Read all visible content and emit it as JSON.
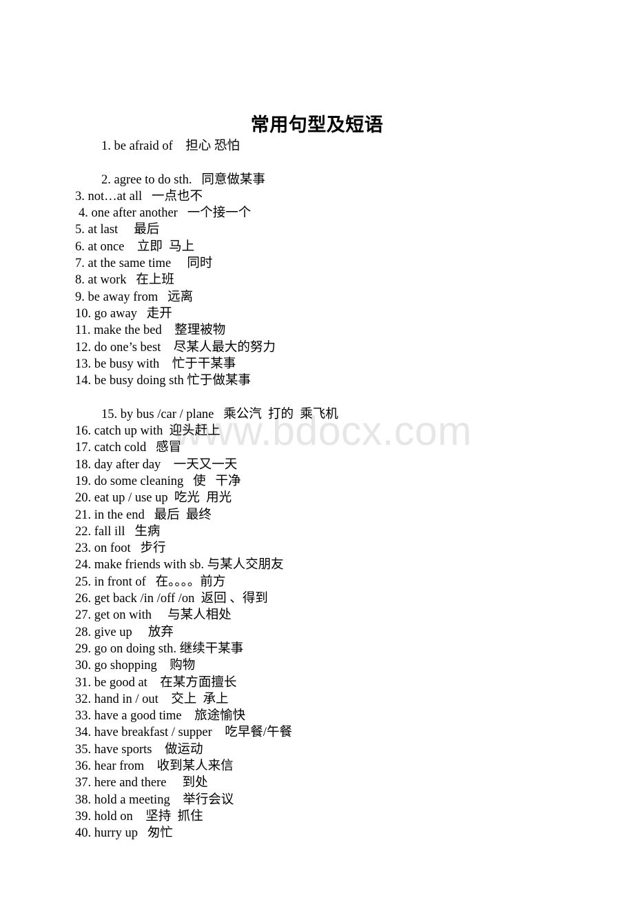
{
  "document": {
    "title": "常用句型及短语",
    "watermark": "www.bdocx.com",
    "watermark_color": "#e6e6e6",
    "background_color": "#ffffff",
    "text_color": "#000000"
  },
  "phrases": [
    {
      "num": "1.",
      "english": "be afraid of",
      "chinese": "担心 恐怕",
      "text": "1. be afraid of    担心 恐怕",
      "indent": "big"
    },
    {
      "num": "",
      "english": "",
      "chinese": "",
      "text": "",
      "indent": "spacer"
    },
    {
      "num": "2.",
      "english": "agree to do sth.",
      "chinese": "同意做某事",
      "text": "2. agree to do sth.   同意做某事",
      "indent": "big"
    },
    {
      "num": "3.",
      "english": "not…at all",
      "chinese": "一点也不",
      "text": "3. not…at all   一点也不",
      "indent": "none"
    },
    {
      "num": "4.",
      "english": "one after another",
      "chinese": "一个接一个",
      "text": "4. one after another   一个接一个",
      "indent": "small"
    },
    {
      "num": "5.",
      "english": "at last",
      "chinese": "最后",
      "text": "5. at last     最后",
      "indent": "none"
    },
    {
      "num": "6.",
      "english": "at once",
      "chinese": "立即 马上",
      "text": "6. at once    立即  马上",
      "indent": "none"
    },
    {
      "num": "7.",
      "english": "at the same time",
      "chinese": "同时",
      "text": "7. at the same time     同时",
      "indent": "none"
    },
    {
      "num": "8.",
      "english": "at work",
      "chinese": "在上班",
      "text": "8. at work   在上班",
      "indent": "none"
    },
    {
      "num": "9.",
      "english": "be away from",
      "chinese": "远离",
      "text": "9. be away from   远离",
      "indent": "none"
    },
    {
      "num": "10.",
      "english": "go away",
      "chinese": "走开",
      "text": "10. go away   走开",
      "indent": "none"
    },
    {
      "num": "11.",
      "english": "make the bed",
      "chinese": "整理被物",
      "text": "11. make the bed    整理被物",
      "indent": "none"
    },
    {
      "num": "12.",
      "english": "do one's best",
      "chinese": "尽某人最大的努力",
      "text": "12. do one’s best    尽某人最大的努力",
      "indent": "none"
    },
    {
      "num": "13.",
      "english": "be busy with",
      "chinese": "忙于干某事",
      "text": "13. be busy with    忙于干某事",
      "indent": "none"
    },
    {
      "num": "14.",
      "english": "be busy doing sth",
      "chinese": "忙于做某事",
      "text": "14. be busy doing sth 忙于做某事",
      "indent": "none"
    },
    {
      "num": "",
      "english": "",
      "chinese": "",
      "text": "",
      "indent": "spacer"
    },
    {
      "num": "15.",
      "english": "by bus /car / plane",
      "chinese": "乘公汽 打的 乘飞机",
      "text": "15. by bus /car / plane   乘公汽  打的  乘飞机",
      "indent": "big"
    },
    {
      "num": "16.",
      "english": "catch up with",
      "chinese": "迎头赶上",
      "text": "16. catch up with  迎头赶上",
      "indent": "none"
    },
    {
      "num": "17.",
      "english": "catch cold",
      "chinese": "感冒",
      "text": "17. catch cold   感冒",
      "indent": "none"
    },
    {
      "num": "18.",
      "english": "day after day",
      "chinese": "一天又一天",
      "text": "18. day after day    一天又一天",
      "indent": "none"
    },
    {
      "num": "19.",
      "english": "do some cleaning",
      "chinese": "使 干净",
      "text": "19. do some cleaning   使   干净",
      "indent": "none"
    },
    {
      "num": "20.",
      "english": "eat up / use up",
      "chinese": "吃光 用光",
      "text": "20. eat up / use up  吃光  用光",
      "indent": "none"
    },
    {
      "num": "21.",
      "english": "in the end",
      "chinese": "最后 最终",
      "text": "21. in the end   最后  最终",
      "indent": "none"
    },
    {
      "num": "22.",
      "english": "fall ill",
      "chinese": "生病",
      "text": "22. fall ill   生病",
      "indent": "none"
    },
    {
      "num": "23.",
      "english": "on foot",
      "chinese": "步行",
      "text": "23. on foot   步行",
      "indent": "none"
    },
    {
      "num": "24.",
      "english": "make friends with sb.",
      "chinese": "与某人交朋友",
      "text": "24. make friends with sb. 与某人交朋友",
      "indent": "none"
    },
    {
      "num": "25.",
      "english": "in front of",
      "chinese": "在。。。。前方",
      "text": "25. in front of   在。。。。前方",
      "indent": "none"
    },
    {
      "num": "26.",
      "english": "get back /in /off /on",
      "chinese": "返回 、得到",
      "text": "26. get back /in /off /on  返回 、得到",
      "indent": "none"
    },
    {
      "num": "27.",
      "english": "get on with",
      "chinese": "与某人相处",
      "text": "27. get on with     与某人相处",
      "indent": "none"
    },
    {
      "num": "28.",
      "english": "give up",
      "chinese": "放弃",
      "text": "28. give up     放弃",
      "indent": "none"
    },
    {
      "num": "29.",
      "english": "go on doing sth.",
      "chinese": "继续干某事",
      "text": "29. go on doing sth. 继续干某事",
      "indent": "none"
    },
    {
      "num": "30.",
      "english": "go shopping",
      "chinese": "购物",
      "text": "30. go shopping    购物",
      "indent": "none"
    },
    {
      "num": "31.",
      "english": "be good at",
      "chinese": "在某方面擅长",
      "text": "31. be good at    在某方面擅长",
      "indent": "none"
    },
    {
      "num": "32.",
      "english": "hand in / out",
      "chinese": "交上 承上",
      "text": "32. hand in / out    交上  承上",
      "indent": "none"
    },
    {
      "num": "33.",
      "english": "have a good time",
      "chinese": "旅途愉快",
      "text": "33. have a good time    旅途愉快",
      "indent": "none"
    },
    {
      "num": "34.",
      "english": "have breakfast / supper",
      "chinese": "吃早餐/午餐",
      "text": "34. have breakfast / supper    吃早餐/午餐",
      "indent": "none"
    },
    {
      "num": "35.",
      "english": "have sports",
      "chinese": "做运动",
      "text": "35. have sports    做运动",
      "indent": "none"
    },
    {
      "num": "36.",
      "english": "hear from",
      "chinese": "收到某人来信",
      "text": "36. hear from    收到某人来信",
      "indent": "none"
    },
    {
      "num": "37.",
      "english": "here and there",
      "chinese": "到处",
      "text": "37. here and there     到处",
      "indent": "none"
    },
    {
      "num": "38.",
      "english": "hold a meeting",
      "chinese": "举行会议",
      "text": "38. hold a meeting    举行会议",
      "indent": "none"
    },
    {
      "num": "39.",
      "english": "hold on",
      "chinese": "坚持 抓住",
      "text": "39. hold on    坚持  抓住",
      "indent": "none"
    },
    {
      "num": "40.",
      "english": "hurry up",
      "chinese": "匆忙",
      "text": "40. hurry up   匆忙",
      "indent": "none"
    }
  ]
}
